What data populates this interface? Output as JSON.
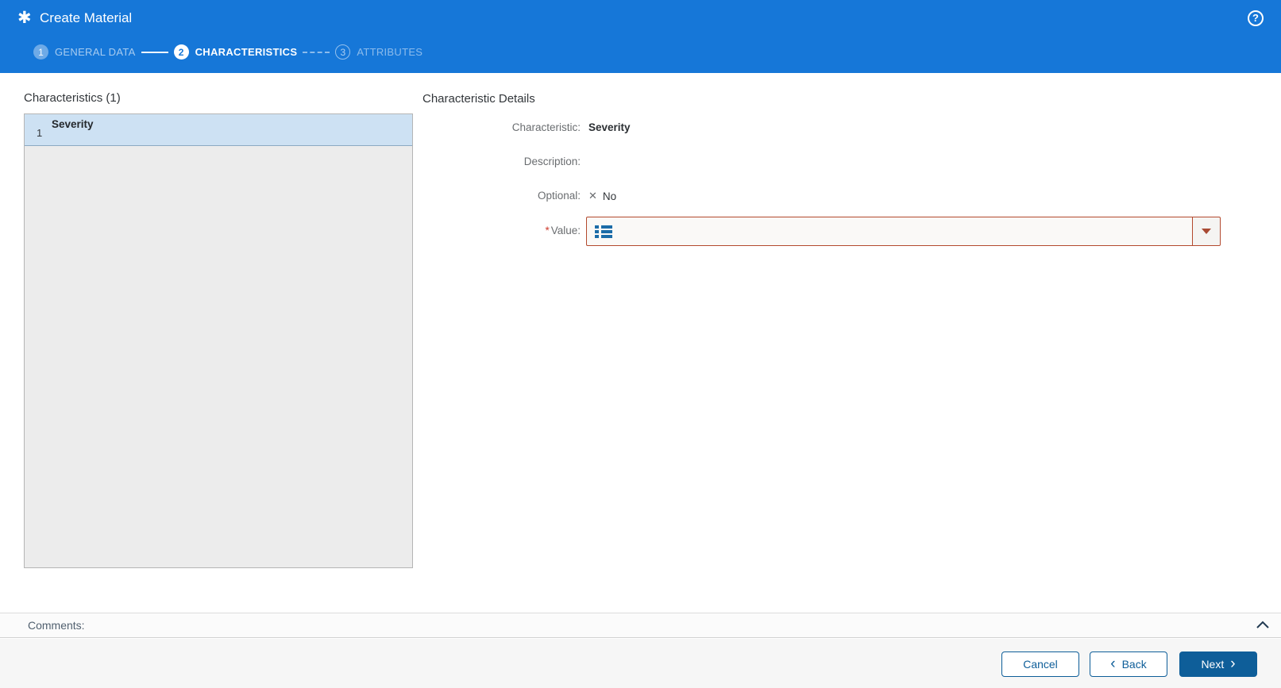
{
  "header": {
    "title": "Create Material",
    "steps": [
      {
        "number": "1",
        "label": "GENERAL DATA"
      },
      {
        "number": "2",
        "label": "CHARACTERISTICS"
      },
      {
        "number": "3",
        "label": "ATTRIBUTES"
      }
    ],
    "active_step": 2
  },
  "characteristics_panel": {
    "title": "Characteristics (1)",
    "items": [
      {
        "index": "1",
        "name": "Severity",
        "selected": true
      }
    ]
  },
  "details_panel": {
    "title": "Characteristic Details",
    "rows": [
      {
        "label": "Characteristic:",
        "value": "Severity"
      },
      {
        "label": "Description:",
        "value": ""
      },
      {
        "label": "Optional:",
        "value": "No"
      },
      {
        "label": "Value:",
        "required": "*",
        "value": ""
      }
    ]
  },
  "comments_bar": {
    "label": "Comments:"
  },
  "footer": {
    "cancel": "Cancel",
    "back": "Back",
    "next": "Next"
  },
  "icons": {
    "app": "✱",
    "help": "?",
    "decline": "✕",
    "back_chevron": "‹",
    "next_chevron": "›"
  },
  "colors": {
    "header_blue": "#1677d8",
    "accent_blue": "#0e5e99",
    "error_border": "#b3492e",
    "selected_row": "#cde1f3",
    "value_help_icon_blue": "#1b6ca8",
    "required_red": "#ce3b2d"
  }
}
